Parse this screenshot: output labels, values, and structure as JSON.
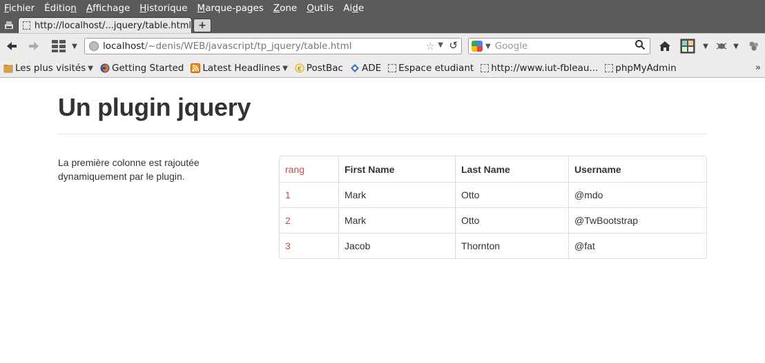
{
  "menubar": {
    "items": [
      {
        "pre": "",
        "u": "F",
        "post": "ichier"
      },
      {
        "pre": "Éditio",
        "u": "n",
        "post": ""
      },
      {
        "pre": "",
        "u": "A",
        "post": "ffichage"
      },
      {
        "pre": "",
        "u": "H",
        "post": "istorique"
      },
      {
        "pre": "",
        "u": "M",
        "post": "arque-pages"
      },
      {
        "pre": "",
        "u": "Z",
        "post": "one"
      },
      {
        "pre": "",
        "u": "O",
        "post": "utils"
      },
      {
        "pre": "Ai",
        "u": "d",
        "post": "e"
      }
    ]
  },
  "tab": {
    "title": "http://localhost/...jquery/table.html"
  },
  "newtab": {
    "label": "+"
  },
  "urlbar": {
    "host": "localhost",
    "path": "/~denis/WEB/javascript/tp_jquery/table.html"
  },
  "search": {
    "placeholder": "Google"
  },
  "bookmarks": [
    {
      "label": "Les plus visités",
      "caret": true,
      "icon": "folder-icon"
    },
    {
      "label": "Getting Started",
      "caret": false,
      "icon": "firefox-icon"
    },
    {
      "label": "Latest Headlines",
      "caret": true,
      "icon": "rss-icon"
    },
    {
      "label": "PostBac",
      "caret": false,
      "icon": "postbac-icon"
    },
    {
      "label": "ADE",
      "caret": false,
      "icon": "ade-icon"
    },
    {
      "label": "Espace etudiant",
      "caret": false,
      "icon": "page-icon"
    },
    {
      "label": "http://www.iut-fbleau...",
      "caret": false,
      "icon": "page-icon"
    },
    {
      "label": "phpMyAdmin",
      "caret": false,
      "icon": "page-icon"
    }
  ],
  "page": {
    "title": "Un plugin jquery",
    "description": "La première colonne est rajoutée dynamiquement par le plugin.",
    "table": {
      "headers": [
        "rang",
        "First Name",
        "Last Name",
        "Username"
      ],
      "rows": [
        [
          "1",
          "Mark",
          "Otto",
          "@mdo"
        ],
        [
          "2",
          "Mark",
          "Otto",
          "@TwBootstrap"
        ],
        [
          "3",
          "Jacob",
          "Thornton",
          "@fat"
        ]
      ]
    }
  },
  "colors": {
    "menubar": "#5b5b5b",
    "toolbar": "#edeceb",
    "rang_accent": "#c0504d",
    "text": "#333333"
  }
}
